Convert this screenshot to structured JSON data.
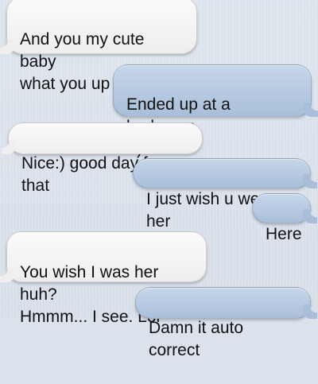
{
  "conversation": {
    "messages": [
      {
        "direction": "incoming",
        "text": "And you my cute baby\nwhat you up too?"
      },
      {
        "direction": "outgoing",
        "text": "Ended up at a barbecue\n:-) ."
      },
      {
        "direction": "incoming",
        "text": "Nice:) good day for that"
      },
      {
        "direction": "outgoing",
        "text": "I just wish u were her"
      },
      {
        "direction": "outgoing",
        "text": "Here"
      },
      {
        "direction": "incoming",
        "text": "You wish I was her huh?\nHmmm... I see. Lol"
      },
      {
        "direction": "outgoing",
        "text": "Damn it auto correct"
      }
    ]
  },
  "colors": {
    "background": "#dbe2ec",
    "incoming_bubble": "#f3f3f3",
    "outgoing_bubble": "#b7cae2"
  }
}
